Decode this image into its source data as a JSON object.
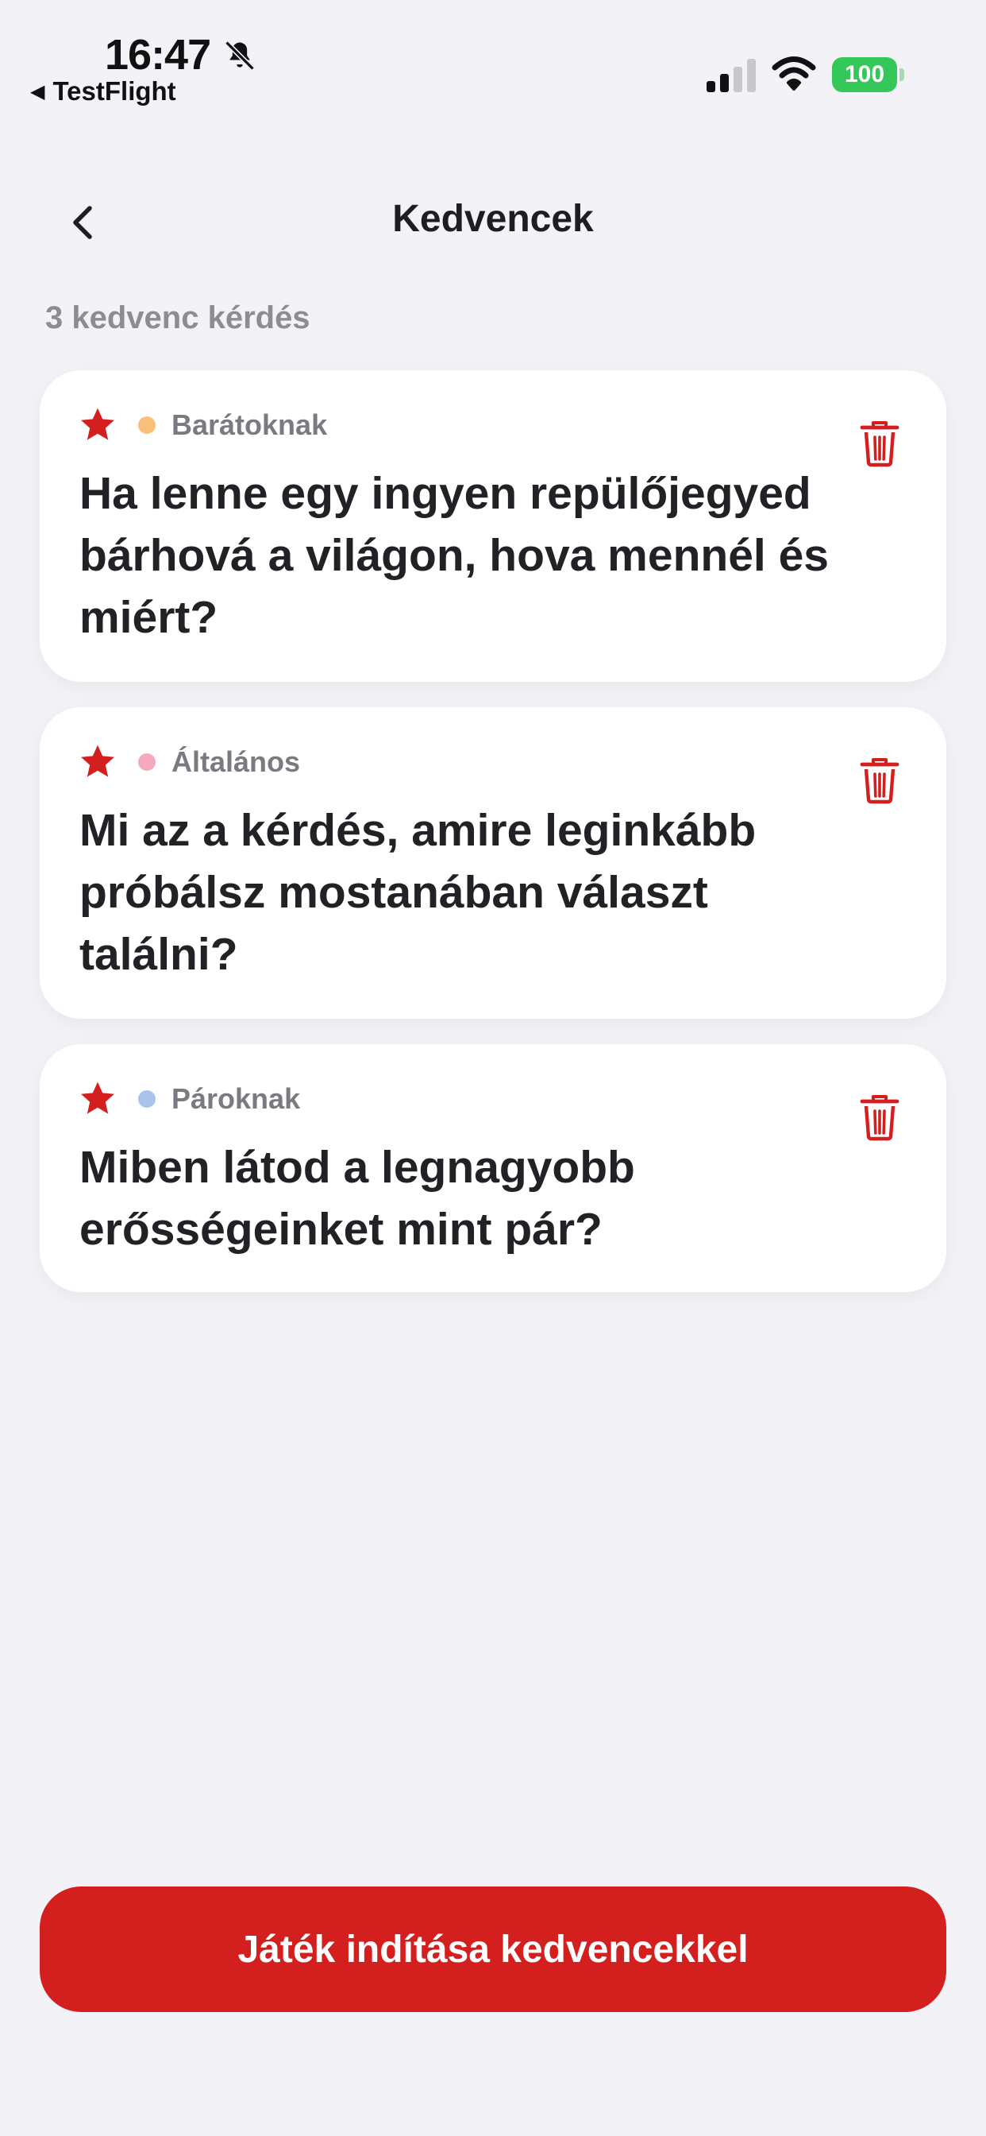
{
  "status_bar": {
    "time": "16:47",
    "back_app": "TestFlight",
    "battery": "100",
    "icons": [
      "bell-slash-icon",
      "cellular-signal-icon",
      "wifi-icon",
      "battery-icon"
    ]
  },
  "nav": {
    "title": "Kedvencek",
    "back_icon": "chevron-left-icon"
  },
  "count_label": "3 kedvenc kérdés",
  "colors": {
    "accent": "#d41f1f",
    "background": "#f3f2f7",
    "card": "#ffffff"
  },
  "cards": [
    {
      "category": "Barátoknak",
      "category_color": "#f8c07a",
      "question": "Ha lenne egy ingyen repülőjegyed bárhová a világon, hova mennél és miért?",
      "favorite_icon": "star-icon",
      "delete_icon": "trash-icon"
    },
    {
      "category": "Általános",
      "category_color": "#f5a9bf",
      "question": "Mi az a kérdés, amire leginkább próbálsz mostanában választ találni?",
      "favorite_icon": "star-icon",
      "delete_icon": "trash-icon"
    },
    {
      "category": "Pároknak",
      "category_color": "#a9c4ea",
      "question": "Miben látod a legnagyobb erősségeinket mint pár?",
      "favorite_icon": "star-icon",
      "delete_icon": "trash-icon"
    }
  ],
  "start_button": "Játék indítása kedvencekkel"
}
